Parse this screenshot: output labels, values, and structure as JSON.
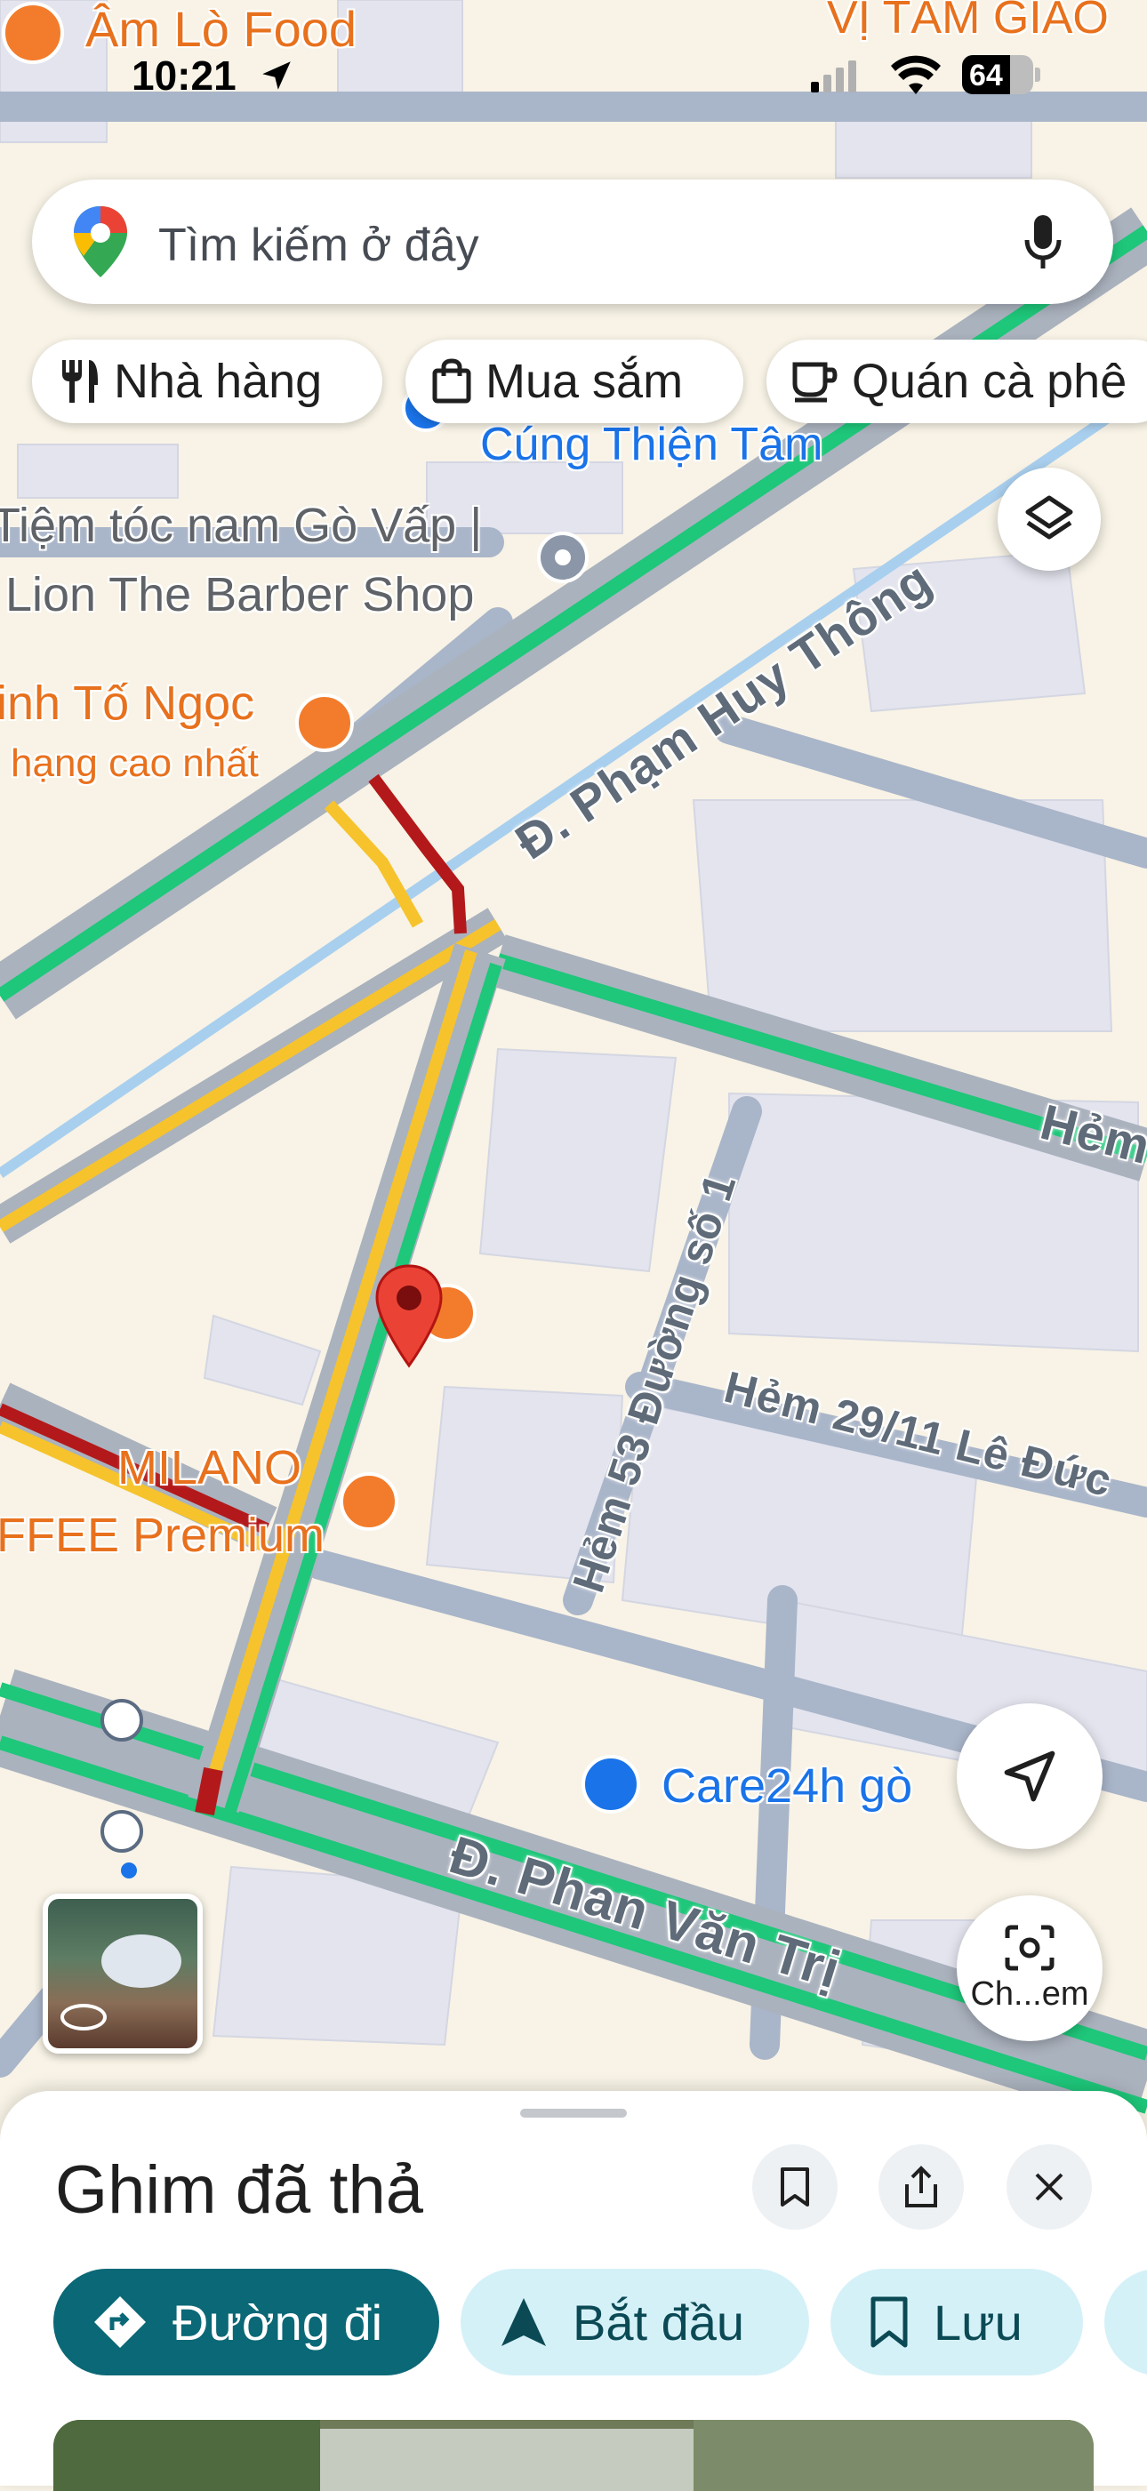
{
  "status_bar": {
    "time": "10:21",
    "battery": "64"
  },
  "search": {
    "placeholder": "Tìm kiếm ở đây"
  },
  "chips": [
    {
      "label": "Nhà hàng",
      "icon": "fork-knife-icon"
    },
    {
      "label": "Mua sắm",
      "icon": "shopping-bag-icon"
    },
    {
      "label": "Quán cà phê",
      "icon": "coffee-cup-icon"
    }
  ],
  "map": {
    "places": [
      {
        "name": "Âm Lò Food"
      },
      {
        "name": "VỊ TÂM GIAO"
      },
      {
        "name": "Cúng Thiện Tâm"
      },
      {
        "name": "Tiệm tóc nam Gò Vấp |"
      },
      {
        "name": "Lion The Barber Shop"
      },
      {
        "name": "inh Tố Ngọc"
      },
      {
        "name": "hạng cao nhất"
      },
      {
        "name": "MILANO"
      },
      {
        "name": "FFEE Premium"
      },
      {
        "name": "Care24h gò"
      }
    ],
    "streets": [
      {
        "name": "Đ. Phạm Huy Thông"
      },
      {
        "name": "Hẻm 53 Đường số 1"
      },
      {
        "name": "Hẻm 29/11 Lê Đức"
      },
      {
        "name": "Đ. Phan Văn Trị"
      },
      {
        "name": "Hẻm"
      }
    ],
    "colors": {
      "traffic_green": "#1ec77a",
      "traffic_yellow": "#f6c32c",
      "traffic_red": "#b3191a",
      "pin": "#ea4335",
      "poi_orange": "#f27c2b"
    }
  },
  "map_controls": {
    "street_view_label": "Ch...em"
  },
  "sheet": {
    "title": "Ghim đã thả",
    "actions": [
      {
        "label": "Đường đi",
        "icon": "directions-icon"
      },
      {
        "label": "Bắt đầu",
        "icon": "navigation-arrow-icon"
      },
      {
        "label": "Lưu",
        "icon": "bookmark-icon"
      }
    ]
  }
}
